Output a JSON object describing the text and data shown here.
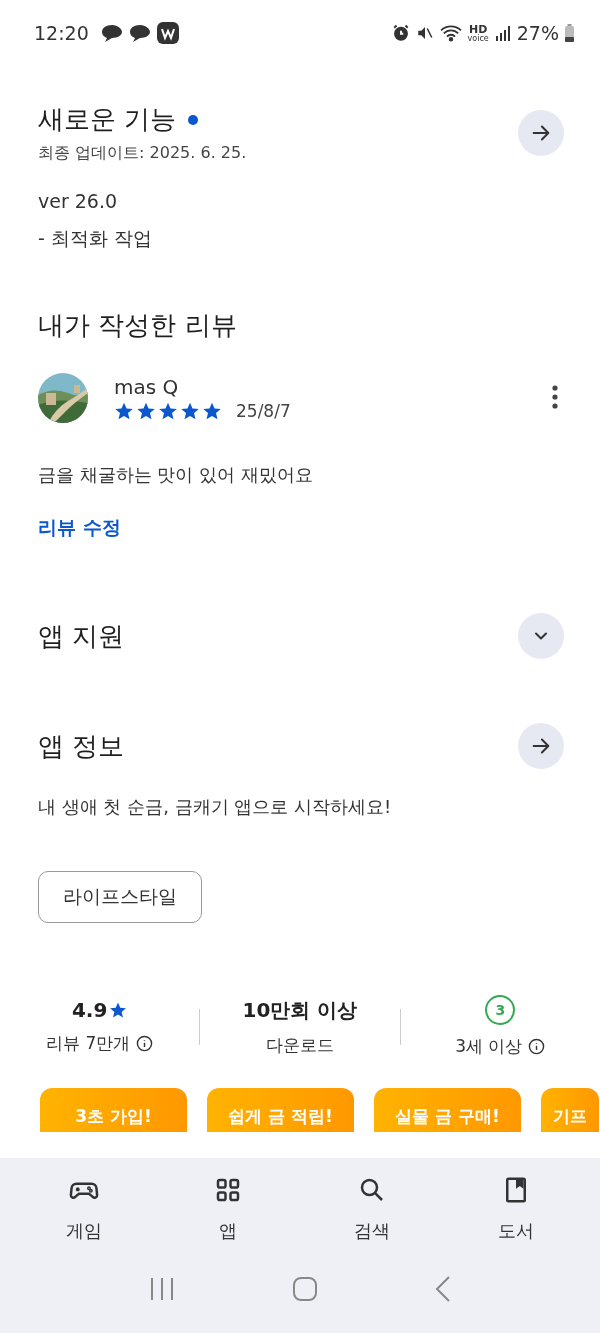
{
  "status_bar": {
    "time": "12:20",
    "hd_label": "HD",
    "hd_sub": "voice",
    "battery": "27%"
  },
  "whats_new": {
    "title": "새로운 기능",
    "updated": "최종 업데이트: 2025. 6. 25.",
    "lines": [
      "ver 26.0",
      "- 최적화 작업"
    ]
  },
  "my_review": {
    "title": "내가 작성한 리뷰",
    "author": "mas Q",
    "stars": 5,
    "date": "25/8/7",
    "text": "금을 채굴하는 맛이 있어 재밌어요",
    "edit_link": "리뷰 수정"
  },
  "app_support": {
    "title": "앱 지원",
    "expanded": false
  },
  "app_info": {
    "title": "앱 정보",
    "description": "내 생애 첫 순금, 금캐기 앱으로 시작하세요!",
    "category": "라이프스타일"
  },
  "stats": [
    {
      "kind": "rating",
      "value": "4.9",
      "label": "리뷰 7만개"
    },
    {
      "kind": "plain",
      "value": "10만회 이상",
      "label": "다운로드"
    },
    {
      "kind": "age",
      "value": "3",
      "label": "3세 이상"
    }
  ],
  "banners": [
    "3초 가입!",
    "쉽게 금 적립!",
    "실물 금 구매!",
    "기프"
  ],
  "bottom_nav": [
    {
      "kind": "games",
      "label": "게임"
    },
    {
      "kind": "apps",
      "label": "앱"
    },
    {
      "kind": "search",
      "label": "검색"
    },
    {
      "kind": "books",
      "label": "도서"
    }
  ]
}
